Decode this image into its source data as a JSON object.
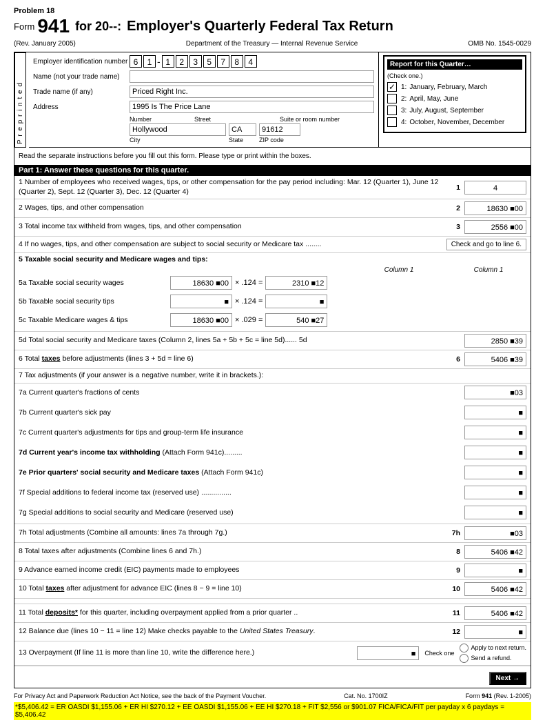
{
  "problem": "Problem 18",
  "form": {
    "number": "Form",
    "big_number": "941",
    "for_text": "for 20--:",
    "title": "Employer's Quarterly Federal Tax Return",
    "rev": "(Rev. January 2005)",
    "dept": "Department of the Treasury — Internal Revenue Service",
    "omb": "OMB No. 1545-0029"
  },
  "employer": {
    "ein_label": "Employer identification number",
    "ein_digits": [
      "6",
      "1",
      "-",
      "1",
      "2",
      "3",
      "5",
      "7",
      "8",
      "4"
    ],
    "name_label": "Name (not your trade name)",
    "name_value": "",
    "trade_label": "Trade name (if any)",
    "trade_value": "Priced Right Inc.",
    "address_label": "Address",
    "address_line1": "1995 Is The Price Lane",
    "number_label": "Number",
    "street_label": "Street",
    "suite_label": "Suite or room number",
    "city_value": "Hollywood",
    "state_value": "CA",
    "zip_value": "91612",
    "city_label": "City",
    "state_label": "State",
    "zip_label": "ZIP code"
  },
  "report_quarter": {
    "title": "Report for this Quarter…",
    "subtitle": "(Check one.)",
    "quarters": [
      {
        "num": "1:",
        "label": "January, February, March",
        "checked": true
      },
      {
        "num": "2:",
        "label": "April, May, June",
        "checked": false
      },
      {
        "num": "3:",
        "label": "July, August, September",
        "checked": false
      },
      {
        "num": "4:",
        "label": "October, November, December",
        "checked": false
      }
    ]
  },
  "preprinted": "P r e p r i n t e d",
  "read_instructions": "Read the separate instructions before you fill out this form. Please type or print within the boxes.",
  "part1_header": "Part 1: Answer these questions for this quarter.",
  "lines": {
    "line1": {
      "text": "1 Number of employees who received wages, tips, or other compensation for the pay period including: Mar. 12 (Quarter 1), June 12 (Quarter 2), Sept. 12 (Quarter 3), Dec. 12 (Quarter 4)",
      "num": "1",
      "value": "4"
    },
    "line2": {
      "text": "2 Wages, tips, and other compensation",
      "num": "2",
      "value": "18630 ■00"
    },
    "line3": {
      "text": "3 Total income tax withheld from wages, tips, and other compensation",
      "num": "3",
      "value": "2556 ■00"
    },
    "line4": {
      "text": "4 If no wages, tips, and other compensation are subject to social security or Medicare tax ........",
      "check_label": "Check and go to line 6."
    },
    "line5_header": "5 Taxable social security and Medicare wages and tips:",
    "col1_label": "Column 1",
    "col2_label": "Column 1",
    "line5a": {
      "label": "5a Taxable social security wages",
      "col1": "18630 ■00",
      "mult": "× .124 =",
      "col2": "2310 ■12"
    },
    "line5b": {
      "label": "5b Taxable social security tips",
      "col1": "■",
      "mult": "× .124 =",
      "col2": "■"
    },
    "line5c": {
      "label": "5c Taxable Medicare wages & tips",
      "col1": "18630 ■00",
      "mult": "× .029 =",
      "col2": "540 ■27"
    },
    "line5d": {
      "text": "5d Total social security and Medicare taxes (Column 2, lines 5a + 5b + 5c = line 5d)...... 5d",
      "value": "2850 ■39"
    },
    "line6": {
      "text": "6 Total taxes before adjustments (lines 3 + 5d = line 6)",
      "num": "6",
      "value": "5406 ■39",
      "taxes_underline": "taxes"
    },
    "line7_header": "7 Tax adjustments (if your answer is a negative number, write it in brackets.):",
    "line7a": {
      "label": "7a Current quarter's fractions of cents",
      "value": "■03"
    },
    "line7b": {
      "label": "7b Current quarter's sick pay",
      "value": "■"
    },
    "line7c": {
      "label": "7c Current quarter's adjustments for tips and group-term life insurance",
      "value": "■"
    },
    "line7d": {
      "label": "7d Current year's income tax withholding (Attach Form 941c).........",
      "value": "■",
      "bold_part": "7d Current year's income tax withholding"
    },
    "line7e": {
      "label": "7e Prior quarters' social security and Medicare taxes (Attach Form 941c)",
      "value": "■",
      "bold_part": "7e Prior quarters' social security and Medicare taxes"
    },
    "line7f": {
      "label": "7f Special additions to federal income tax (reserved use) ...............",
      "value": "■"
    },
    "line7g": {
      "label": "7g Special additions to social security and Medicare (reserved use)",
      "value": "■"
    },
    "line7h": {
      "text": "7h Total adjustments (Combine all amounts: lines 7a through 7g.)",
      "num": "7h",
      "value": "■03"
    },
    "line8": {
      "text": "8 Total taxes after adjustments (Combine lines 6 and 7h.)",
      "num": "8",
      "value": "5406 ■42"
    },
    "line9": {
      "text": "9 Advance earned income credit (EIC) payments made to employees",
      "num": "9",
      "value": "■"
    },
    "line10": {
      "text": "10 Total taxes after adjustment for advance EIC (lines 8 − 9 = line 10)",
      "num": "10",
      "value": "5406 ■42",
      "taxes_underline": "taxes"
    },
    "line11": {
      "text": "11 Total deposits* for this quarter, including overpayment applied from a prior quarter ..",
      "num": "11",
      "value": "5406 ■42",
      "deposits_underline": "deposits*"
    },
    "line12": {
      "text": "12 Balance due (lines 10 − 11 = line 12) Make checks payable to the United States Treasury.",
      "num": "12",
      "value": "■"
    },
    "line13": {
      "text": "13 Overpayment (If line 11 is more than line 10, write the difference here.)",
      "value": "■",
      "check_one": "Check one",
      "apply": "Apply to next return.",
      "send": "Send a refund."
    }
  },
  "footer": {
    "privacy": "For Privacy Act and Paperwork Reduction Act Notice, see the back of the Payment Voucher.",
    "cat": "Cat. No. 1700IZ",
    "form": "Form",
    "form_num": "941",
    "rev": "(Rev. 1-2005)"
  },
  "next_button": "Next →",
  "yellow_note": "*$5,406.42 = ER OASDI $1,155.06 + ER HI $270.12 + EE OASDI $1,155.06 + EE HI $270.18 + FIT $2,556 or $901.07 FICA/FICA/FIT per payday x 6 paydays = $5,406.42"
}
